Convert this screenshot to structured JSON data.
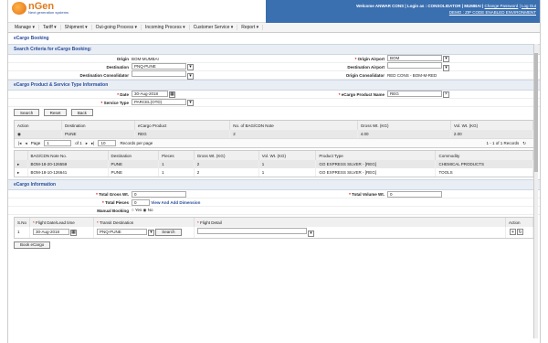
{
  "header": {
    "logo_title": "nGen",
    "logo_sub": "Next generation systems",
    "welcome_text": "Welcome ANWAR CONS | Login as : CONSOLIDATOR | MUMBAI |",
    "change_password": "Change Password",
    "logout": "Log Out",
    "demo_text": "DEMO : ZIP CODE ENABLED ENVIRONMENT"
  },
  "menu": [
    "Manage ▾",
    "Tariff ▾",
    "Shipment ▾",
    "Out-going Process ▾",
    "Incoming Process ▾",
    "Customer Service ▾",
    "Report ▾"
  ],
  "page_title": "eCargo Booking",
  "search": {
    "title": "Search Criteria for eCargo Booking:",
    "origin_label": "Origin",
    "origin_value": "BOM-MUMBAI",
    "origin_airport_label": "Origin Airport",
    "origin_airport_value": "BOM",
    "destination_label": "Destination",
    "destination_value": "PNQ-PUNE",
    "destination_airport_label": "Destination Airport",
    "destination_consolidator_label": "Destination Consolidator",
    "origin_consolidator_label": "Origin Consolidator",
    "origin_consolidator_value": "RED CONS - BOM-M-RED"
  },
  "product": {
    "title": "eCargo Product & Service Type Information",
    "date_label": "Date",
    "date_value": "30-Aug-2018",
    "product_name_label": "eCargo Product Name",
    "product_name_value": "REG",
    "service_type_label": "Service Type",
    "service_type_value": "PARCEL(OTD)"
  },
  "buttons": {
    "search": "Search",
    "reset": "Reset",
    "back": "Back",
    "search2": "Search",
    "book": "Book eCargo"
  },
  "grid1": {
    "headers": [
      "Action",
      "Destination",
      "eCargo Product",
      "No. of BAG/CDN Note",
      "Gross Wt. (KG)",
      "Vol. Wt. (KG)"
    ],
    "rows": [
      [
        "PUNE",
        "REG",
        "2",
        "4.00",
        "2.00"
      ]
    ],
    "page_label": "Page",
    "page_value": "1",
    "of_label": "of 1",
    "per_page_value": "10",
    "per_page_label": "Records per page",
    "records": "1 - 1 of 1 Records"
  },
  "grid2": {
    "headers": [
      "BAG/CDN Note No.",
      "Destination",
      "Pieces",
      "Gross Wt. (KG)",
      "Vol. Wt. (KG)",
      "Product Type",
      "Commodity"
    ],
    "rows": [
      [
        "BOM-18-20-126559",
        "PUNE",
        "1",
        "2",
        "1",
        "GO EXPRESS SILVER - [REG]",
        "CHEMICAL PRODUCTS"
      ],
      [
        "BOM-18-10-126641",
        "PUNE",
        "1",
        "2",
        "1",
        "GO EXPRESS SILVER - [REG]",
        "TOOLS"
      ]
    ]
  },
  "info": {
    "title": "eCargo Information",
    "total_gross_label": "Total Gross Wt.",
    "total_gross_value": "0",
    "total_volume_label": "Total Volume Wt.",
    "total_volume_value": "0",
    "total_pieces_label": "Total Pieces",
    "total_pieces_value": "0",
    "view_add_dimension": "View And Add Dimension",
    "manual_booking_label": "Manual Booking",
    "yes_label": "Yes",
    "no_label": "No"
  },
  "flight": {
    "headers": [
      "S.No",
      "Flight Date/Lead time",
      "Transit Destination",
      "Flight Detail",
      "Action"
    ],
    "sno": "1",
    "date_value": "30-Aug-2018",
    "transit_value": "PNQ-PUNE"
  }
}
